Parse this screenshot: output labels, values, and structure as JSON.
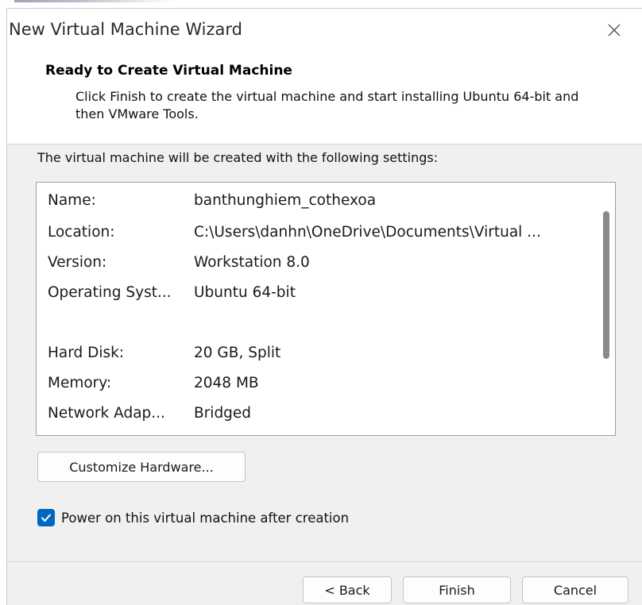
{
  "window": {
    "title": "New Virtual Machine Wizard"
  },
  "header": {
    "title": "Ready to Create Virtual Machine",
    "description": "Click Finish to create the virtual machine and start installing Ubuntu 64-bit and then VMware Tools."
  },
  "settings": {
    "label": "The virtual machine will be created with the following settings:",
    "rows": [
      {
        "key": "Name:",
        "value": "banthunghiem_cothexoa"
      },
      {
        "key": "Location:",
        "value": "C:\\Users\\danhn\\OneDrive\\Documents\\Virtual ..."
      },
      {
        "key": "Version:",
        "value": "Workstation 8.0"
      },
      {
        "key": "Operating Syst...",
        "value": "Ubuntu 64-bit"
      },
      {
        "key": "",
        "value": ""
      },
      {
        "key": "Hard Disk:",
        "value": "20 GB, Split"
      },
      {
        "key": "Memory:",
        "value": "2048 MB"
      },
      {
        "key": "Network Adap...",
        "value": "Bridged"
      }
    ]
  },
  "customize_button": {
    "label": "Customize Hardware..."
  },
  "power_on": {
    "label": "Power on this virtual machine after creation",
    "checked": true
  },
  "footer": {
    "back_label": "< Back",
    "finish_label": "Finish",
    "cancel_label": "Cancel"
  },
  "colors": {
    "accent": "#0067c0",
    "window_bg": "#f0f0f0",
    "panel_bg": "#ffffff"
  },
  "icons": {
    "close": "close-icon",
    "check": "checkmark-icon"
  }
}
